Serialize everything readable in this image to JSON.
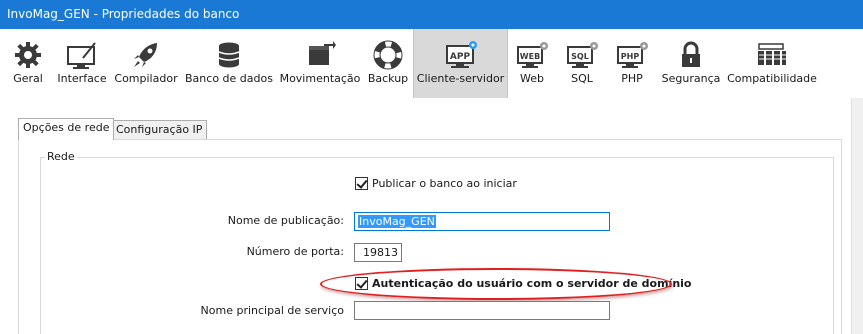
{
  "window": {
    "title": "InvoMag_GEN - Propriedades do banco"
  },
  "toolbar": {
    "items": [
      {
        "label": "Geral",
        "icon": "gear-icon"
      },
      {
        "label": "Interface",
        "icon": "monitor-pen-icon"
      },
      {
        "label": "Compilador",
        "icon": "rocket-icon"
      },
      {
        "label": "Banco de dados",
        "icon": "database-icon"
      },
      {
        "label": "Movimentação",
        "icon": "box-arrow-icon"
      },
      {
        "label": "Backup",
        "icon": "lifebuoy-icon"
      },
      {
        "label": "Cliente-servidor",
        "icon": "app-server-icon",
        "active": true
      },
      {
        "label": "Web",
        "icon": "web-icon"
      },
      {
        "label": "SQL",
        "icon": "sql-icon"
      },
      {
        "label": "PHP",
        "icon": "php-icon"
      },
      {
        "label": "Segurança",
        "icon": "padlock-icon"
      },
      {
        "label": "Compatibilidade",
        "icon": "compatibility-icon"
      }
    ],
    "icon_badge_text": {
      "app": "APP",
      "web": "WEB",
      "sql": "SQL",
      "php": "PHP"
    }
  },
  "tabs": [
    {
      "label": "Opções de rede",
      "active": true
    },
    {
      "label": "Configuração IP",
      "active": false
    }
  ],
  "group": {
    "legend": "Rede",
    "publish_checkbox": {
      "label": "Publicar o banco ao iniciar",
      "checked": true
    },
    "publication_name": {
      "label": "Nome de publicação:",
      "value": "InvoMag_GEN"
    },
    "port": {
      "label": "Número de porta:",
      "value": "19813"
    },
    "auth_checkbox": {
      "label": "Autenticação do usuário com o servidor de domínio",
      "checked": true
    },
    "service_principal": {
      "label": "Nome principal de serviço",
      "value": ""
    }
  },
  "colors": {
    "titlebar": "#1b79d6",
    "selection": "#3399ff",
    "highlight_ellipse": "#e02020"
  }
}
